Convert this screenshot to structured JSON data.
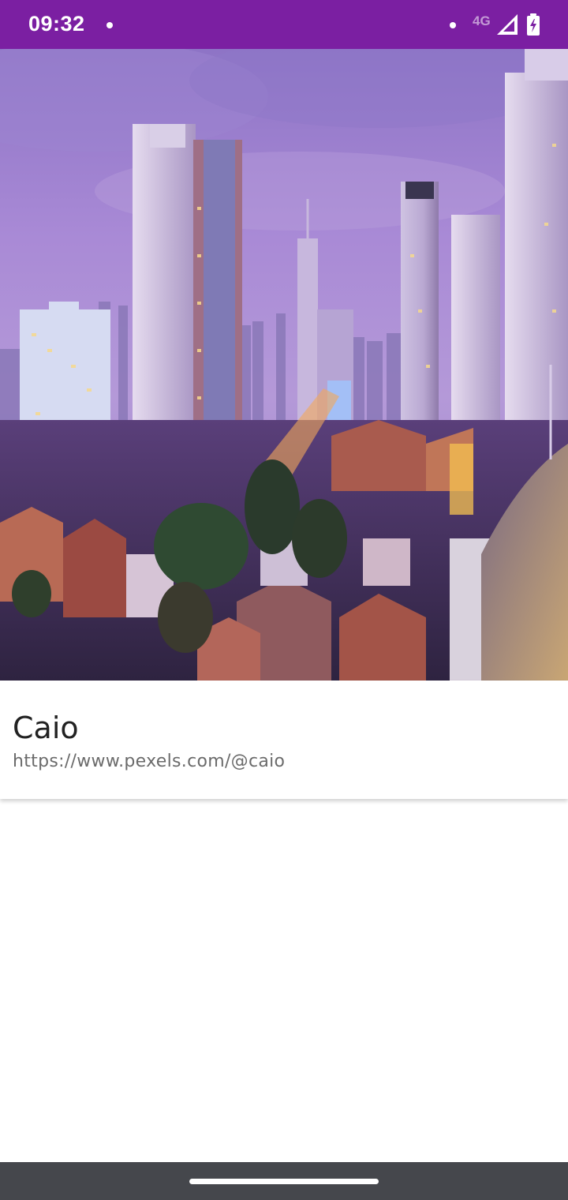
{
  "status_bar": {
    "time": "09:32",
    "network": "4G",
    "background_color": "#7b1fa2"
  },
  "hero_image": {
    "icon": "city-night-photo"
  },
  "card": {
    "title": "Caio",
    "url": "https://www.pexels.com/@caio"
  },
  "nav_bar": {
    "background_color": "#45474c"
  }
}
